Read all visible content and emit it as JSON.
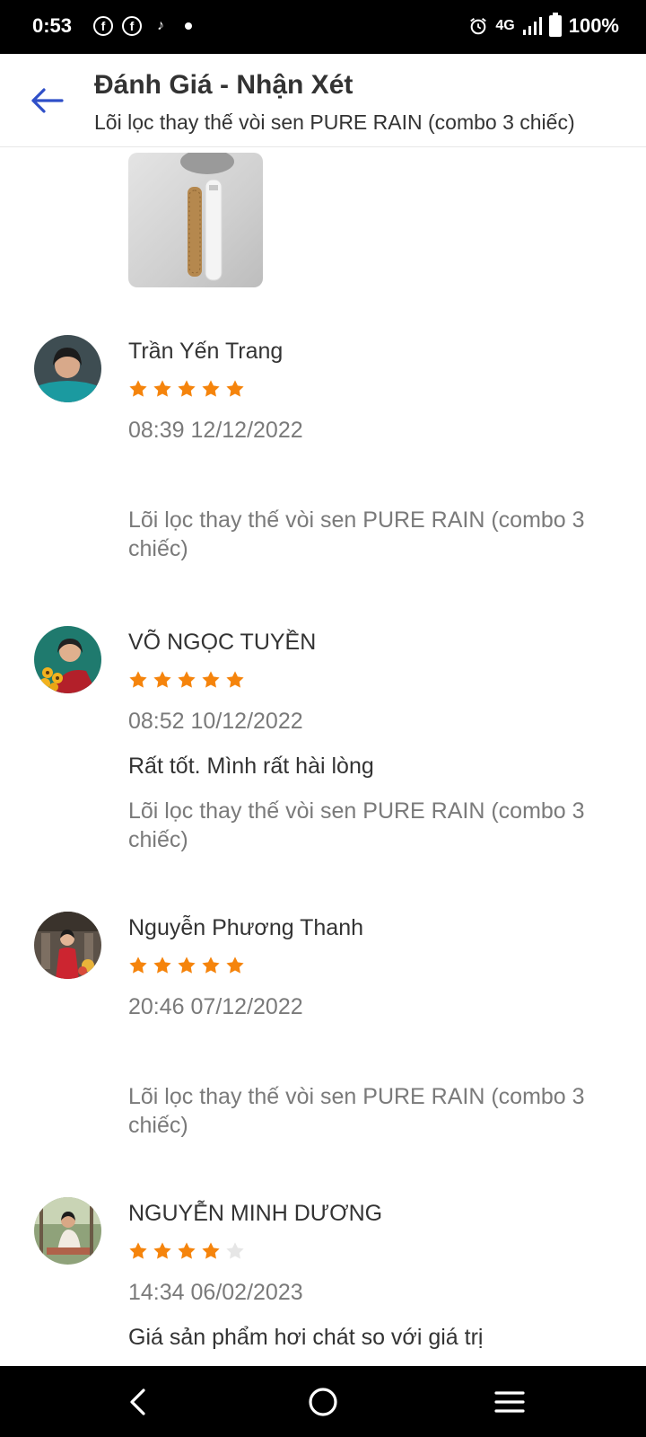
{
  "status_bar": {
    "time": "0:53",
    "network": "4G",
    "battery": "100%",
    "notification_icons": [
      "facebook-icon",
      "facebook-icon",
      "tiktok-icon",
      "dot-icon"
    ]
  },
  "header": {
    "title": "Đánh Giá - Nhận Xét",
    "subtitle": "Lõi lọc thay thế vòi sen PURE RAIN (combo 3 chiếc)"
  },
  "accent_color": "#2f4fc8",
  "star_color": "#f5840c",
  "reviews": [
    {
      "name": "Trần Yến Trang",
      "rating": 5,
      "date": "08:39 12/12/2022",
      "text": "",
      "product": "Lõi lọc thay thế vòi sen PURE RAIN (combo 3 chiếc)"
    },
    {
      "name": "VÕ NGỌC TUYỀN",
      "rating": 5,
      "date": "08:52 10/12/2022",
      "text": "Rất tốt. Mình rất hài lòng",
      "product": "Lõi lọc thay thế vòi sen PURE RAIN (combo 3 chiếc)"
    },
    {
      "name": "Nguyễn Phương Thanh",
      "rating": 5,
      "date": "20:46 07/12/2022",
      "text": "",
      "product": "Lõi lọc thay thế vòi sen PURE RAIN (combo 3 chiếc)"
    },
    {
      "name": "NGUYỄN MINH DƯƠNG",
      "rating": 4,
      "date": "14:34 06/02/2023",
      "text": "Giá sản phẩm hơi chát so với giá trị",
      "product": ""
    }
  ]
}
